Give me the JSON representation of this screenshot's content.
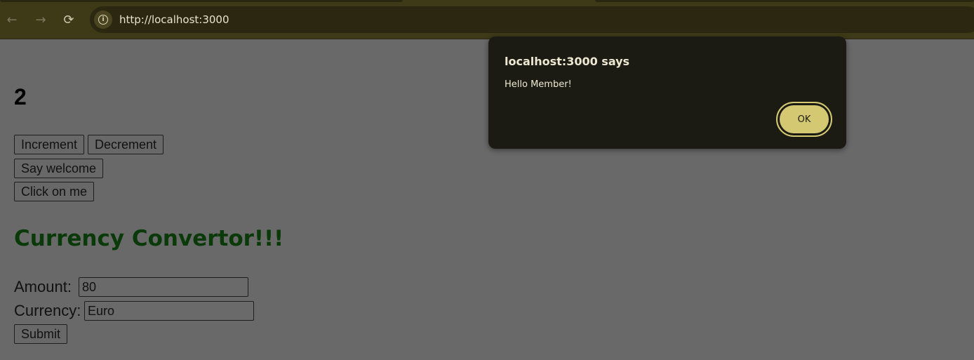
{
  "browser": {
    "url": "http://localhost:3000",
    "back_icon": "←",
    "forward_icon": "→",
    "reload_icon": "⟳",
    "info_icon": "i"
  },
  "page": {
    "counter": "2",
    "buttons": {
      "increment": "Increment",
      "decrement": "Decrement",
      "say_welcome": "Say welcome",
      "click_on_me": "Click on me"
    },
    "converter": {
      "heading": "Currency Convertor!!!",
      "amount_label": "Amount:",
      "amount_value": "80",
      "currency_label": "Currency:",
      "currency_value": "Euro",
      "submit": "Submit"
    }
  },
  "alert": {
    "title": "localhost:3000 says",
    "message": "Hello Member!",
    "ok": "OK"
  },
  "colors": {
    "heading": "#0a3a0a",
    "ok_button": "#d4c972",
    "dialog_bg": "#1c1b13"
  }
}
